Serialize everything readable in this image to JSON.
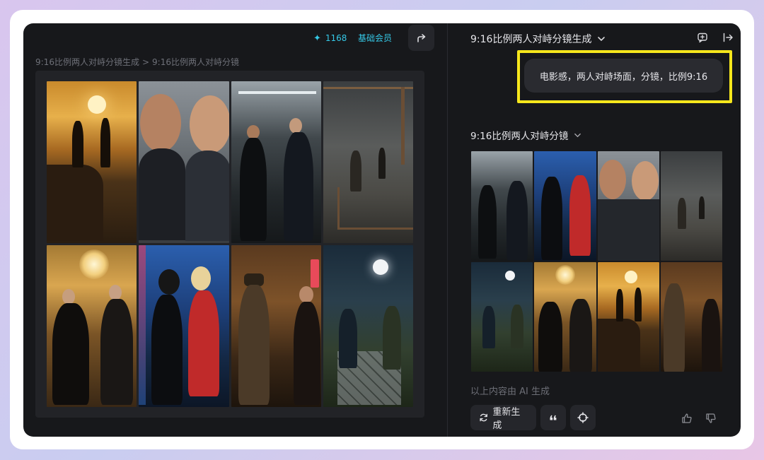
{
  "header": {
    "credits": "1168",
    "membership": "基础会员"
  },
  "breadcrumb": {
    "parent": "9:16比例两人对峙分镜生成",
    "separator": ">",
    "current": "9:16比例两人对峙分镜"
  },
  "conversation": {
    "title": "9:16比例两人对峙分镜生成",
    "prompt": "电影感，两人对峙场面，分镜，比例9:16",
    "result_title": "9:16比例两人对峙分镜",
    "ai_note": "以上内容由 AI 生成",
    "actions": {
      "regenerate": "重新生成"
    }
  },
  "canvas_tiles": [
    "sunset-cliff-couple",
    "office-faceoff-closeup",
    "corridor-suits-faceoff",
    "warehouse-fight-topdown",
    "ballroom-chandelier-faceoff",
    "neon-rain-women-faceoff",
    "bar-interior-faceoff",
    "moonlit-sword-duel"
  ],
  "result_tiles": [
    "corridor-suits-faceoff",
    "neon-rain-women-faceoff",
    "office-faceoff-closeup",
    "warehouse-fight-topdown",
    "moonlit-sword-duel",
    "ballroom-chandelier-faceoff",
    "sunset-cliff-couple",
    "bar-interior-faceoff"
  ],
  "colors": {
    "accent": "#35c8e6",
    "highlight": "#f6e71c",
    "background": "#17181b"
  }
}
